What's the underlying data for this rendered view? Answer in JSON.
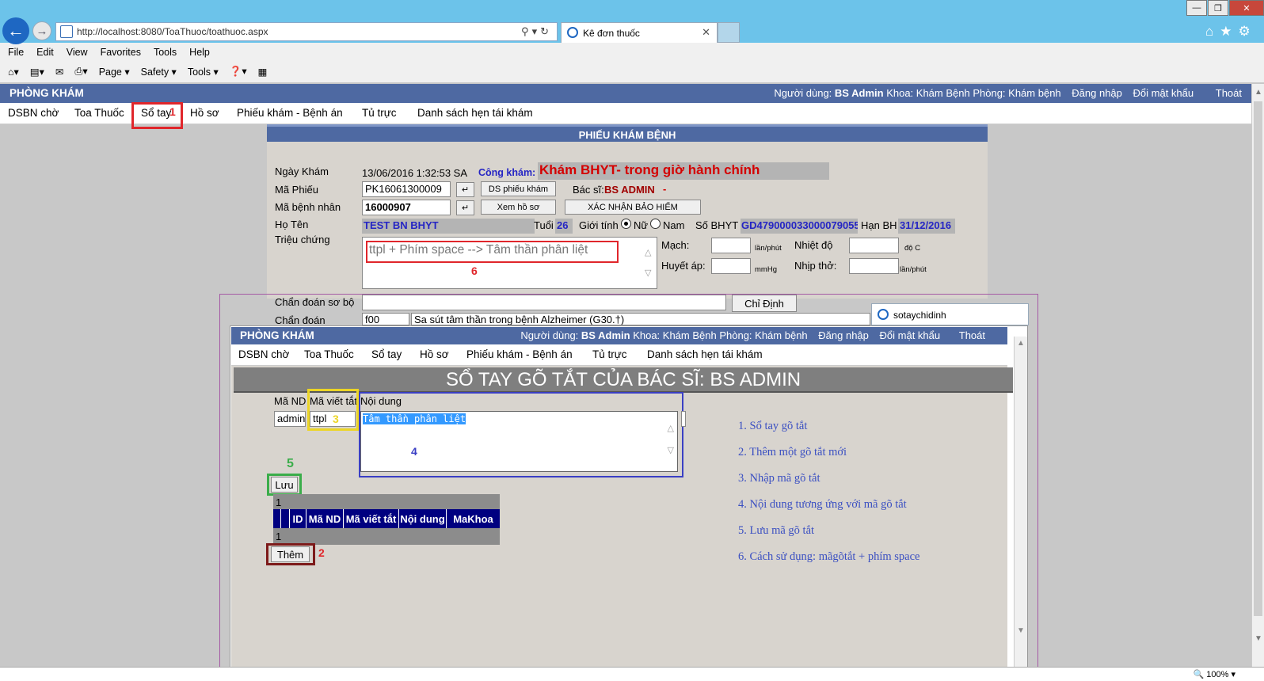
{
  "browser": {
    "url": "http://localhost:8080/ToaThuoc/toathuoc.aspx",
    "tab_title": "Kê đơn thuốc",
    "menu": [
      "File",
      "Edit",
      "View",
      "Favorites",
      "Tools",
      "Help"
    ],
    "commands": [
      "Page ▾",
      "Safety ▾",
      "Tools ▾"
    ],
    "zoom": "100%"
  },
  "app": {
    "title": "PHÒNG KHÁM",
    "user_label": "Người dùng:",
    "user": "BS Admin",
    "khoa": "Khoa: Khám Bệnh",
    "phong": "Phòng: Khám bệnh",
    "login": "Đăng nhập",
    "change_pw": "Đổi mật khẩu",
    "logout": "Thoát",
    "nav": [
      "DSBN chờ",
      "Toa Thuốc",
      "Sổ tay",
      "Hồ sơ",
      "Phiếu khám - Bệnh án",
      "Tủ trực",
      "Danh sách hẹn tái khám"
    ]
  },
  "form": {
    "title": "PHIẾU KHÁM BỆNH",
    "ngay_kham_label": "Ngày Khám",
    "ngay_kham": "13/06/2016 1:32:53 SA",
    "cong_kham_label": "Công khám:",
    "cong_kham": "Khám BHYT- trong giờ hành chính",
    "ma_phieu_label": "Mã Phiếu",
    "ma_phieu": "PK16061300009",
    "ds_phieu_btn": "DS phiếu khám",
    "bac_si_label": "Bác sĩ:",
    "bac_si": "BS ADMIN",
    "bac_si_dash": "-",
    "ma_bn_label": "Mã bệnh nhân",
    "ma_bn": "16000907",
    "xem_ho_so_btn": "Xem hồ sơ",
    "xac_nhan_btn": "XÁC NHẬN BẢO HIỂM",
    "ho_ten_label": "Họ Tên",
    "ho_ten": "TEST BN BHYT",
    "tuoi_label": "Tuổi",
    "tuoi": "26",
    "gioi_tinh_label": "Giới tính",
    "nu": "Nữ",
    "nam": "Nam",
    "so_bhyt_label": "Số BHYT",
    "so_bhyt": "GD479000033000079055",
    "han_bh_label": "Hạn BH",
    "han_bh": "31/12/2016",
    "trieu_chung_label": "Triệu chứng",
    "trieu_chung_hint": "ttpl + Phím space --> Tâm thần phân liệt",
    "mach_label": "Mạch:",
    "mach_unit": "lần/phút",
    "nhiet_do_label": "Nhiệt độ",
    "nhiet_do_unit": "độ C",
    "huyet_ap_label": "Huyết áp:",
    "huyet_ap_unit": "mmHg",
    "nhip_tho_label": "Nhịp thở:",
    "nhip_tho_unit": "lần/phút",
    "chan_doan_so_bo_label": "Chẩn đoán sơ bộ",
    "chi_dinh_btn": "Chỉ Định",
    "chan_doan_label": "Chẩn đoán",
    "chan_doan_code": "f00",
    "chan_doan_text": "Sa sút tâm thần trong bệnh Alzheimer (G30.†)"
  },
  "popup": {
    "tab_title": "sotaychidinh",
    "heading": "SỔ TAY GÕ TẮT CỦA BÁC SĨ: BS ADMIN",
    "col_ma_nd": "Mã ND",
    "col_ma_viet_tat": "Mã viết tắt",
    "col_noi_dung": "Nội dung",
    "ma_nd_value": "admin",
    "ma_viet_tat_value": "ttpl",
    "noi_dung_value": "Tâm thần phân liệt",
    "save_btn": "Lưu",
    "add_btn": "Thêm",
    "pager_top": "1",
    "pager_bottom": "1",
    "grid_headers": [
      "",
      "",
      "ID",
      "Mã ND",
      "Mã viết tắt",
      "Nội dung",
      "MaKhoa"
    ],
    "instructions": [
      "1. Sổ tay gõ tắt",
      "2. Thêm một gõ tắt mới",
      "3. Nhập mã gõ tắt",
      "4. Nội dung tương ứng với mã gõ tắt",
      "5. Lưu mã gõ tắt",
      "6. Cách sử dụng: mãgõtắt + phím space"
    ]
  },
  "annotations": {
    "a1": "1",
    "a2": "2",
    "a3": "3",
    "a4": "4",
    "a5": "5",
    "a6": "6"
  },
  "colors": {
    "header_blue": "#4e69a2",
    "grid_navy": "#000080",
    "annot_red": "#e0262b",
    "annot_yellow": "#ecd526",
    "annot_blue": "#3a3fc4",
    "annot_green": "#3aad4a",
    "annot_darkred": "#7d1a1a",
    "instruction_blue": "#3a4fc2"
  }
}
